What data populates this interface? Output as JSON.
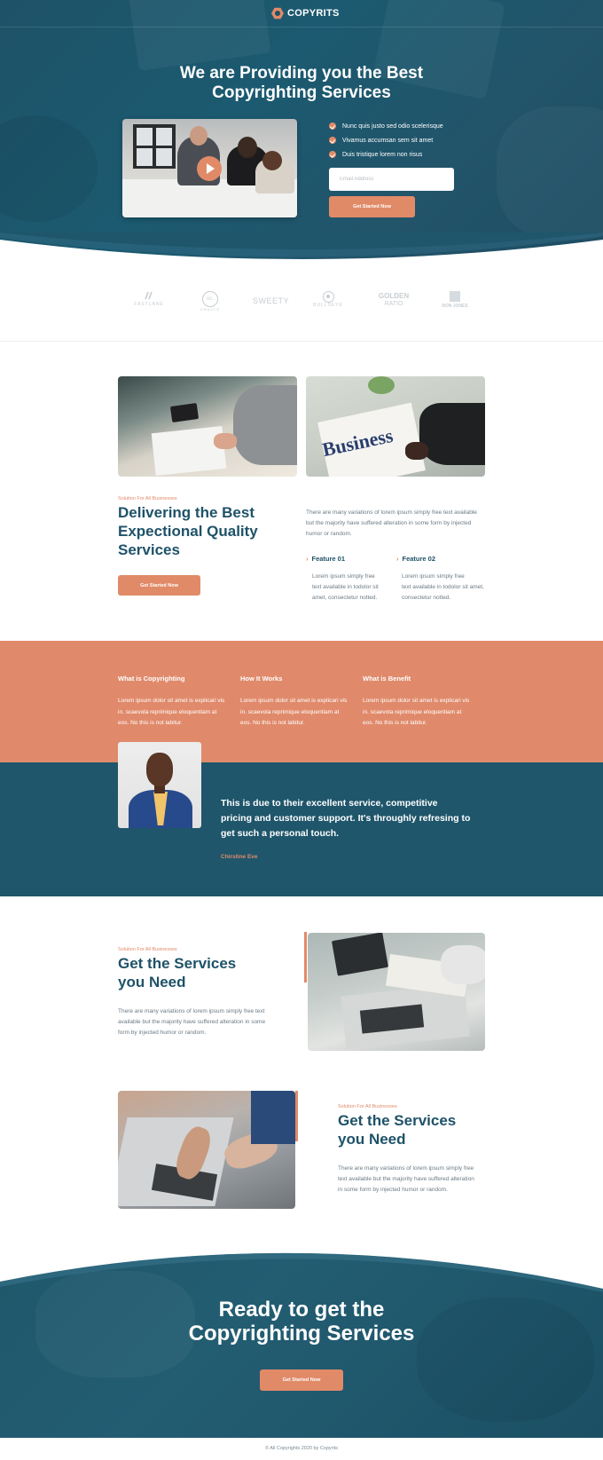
{
  "brand": {
    "name": "COPYRITS",
    "accent": "#e18a68",
    "primary": "#1e5268"
  },
  "hero": {
    "title_line1": "We are Providing you the Best",
    "title_line2": "Copyrighting Services",
    "checks": [
      "Nunc quis justo sed odio scelerisque",
      "Vivamus accumsan sem sit amet",
      "Duis tristique lorem non risus"
    ],
    "email_placeholder": "Email Address",
    "cta_label": "Get Started Now"
  },
  "client_logos": [
    {
      "name": "FASTLANE",
      "icon": "fastlane-icon"
    },
    {
      "name": "ORACLE",
      "icon": "nc-badge-icon",
      "badge": "nc."
    },
    {
      "name": "SWEETY",
      "icon": "sweety-icon"
    },
    {
      "name": "BULLSEYE",
      "icon": "target-icon"
    },
    {
      "name": "GOLDEN RATIO",
      "icon": "golden-icon",
      "top": "GOLDEN",
      "bottom": "RATIO"
    },
    {
      "name": "RON JONES",
      "icon": "square-icon"
    }
  ],
  "delivering": {
    "kicker": "Solution For All Businesses",
    "title_line1": "Delivering the Best",
    "title_line2": "Expectional Quality",
    "title_line3": "Services",
    "button": "Get Started Now",
    "paragraph_l1": "There are many variations of lorem ipsum simply free text available",
    "paragraph_l2": "but the majority have suffered alteration in some form by injected",
    "paragraph_l3": "humor or random.",
    "features": [
      {
        "title": "Feature 01",
        "l1": "Lorem ipsum simply free",
        "l2": "text available in todolor sit",
        "l3": "amet, consectetur notted."
      },
      {
        "title": "Feature 02",
        "l1": "Lorem ipsum simply free",
        "l2": "text available in todolor sit amet,",
        "l3": "consectetur notted."
      }
    ],
    "newspaper_word": "Business"
  },
  "info": [
    {
      "title": "What is Copyrighting",
      "l1": "Lorem ipsum dolor sit amet is explicari vis",
      "l2": "in. scaevola reprimique eloquentiam at",
      "l3": "eos. No this is not labitur."
    },
    {
      "title": "How It Works",
      "l1": "Lorem ipsum dolor sit amet is explicari vis",
      "l2": "in. scaevola reprimique eloquentiam at",
      "l3": "eos. No this is not labitur."
    },
    {
      "title": "What is Benefit",
      "l1": "Lorem ipsum dolor sit amet is explicari vis",
      "l2": "in. scaevola reprimique eloquentiam at",
      "l3": "eos. No this is not labitur."
    }
  ],
  "testimonial": {
    "quote_l1": "This is due to their excellent service, competitive",
    "quote_l2": "pricing and customer support. It's throughly refresing to",
    "quote_l3": "get such a personal touch.",
    "author": "Chirstine Eve"
  },
  "services": [
    {
      "kicker": "Solution For All Businesses",
      "title_l1": "Get the Services",
      "title_l2": "you Need",
      "l1": "There are many variations of lorem ipsum simply free text",
      "l2": "available but the majority have suffered alteration in some",
      "l3": "form by injected humor or random."
    },
    {
      "kicker": "Solution For All Businesses",
      "title_l1": "Get the Services",
      "title_l2": "you Need",
      "l1": "There are many variations of lorem ipsum simply free",
      "l2": "text available but the majority have suffered alteration",
      "l3": "in some form by injected humor or random."
    }
  ],
  "cta": {
    "title_l1": "Ready to get the",
    "title_l2": "Copyrighting Services",
    "button": "Get Started Now"
  },
  "footer": {
    "text": "© All Copyrights 2020 by Copyrits"
  }
}
